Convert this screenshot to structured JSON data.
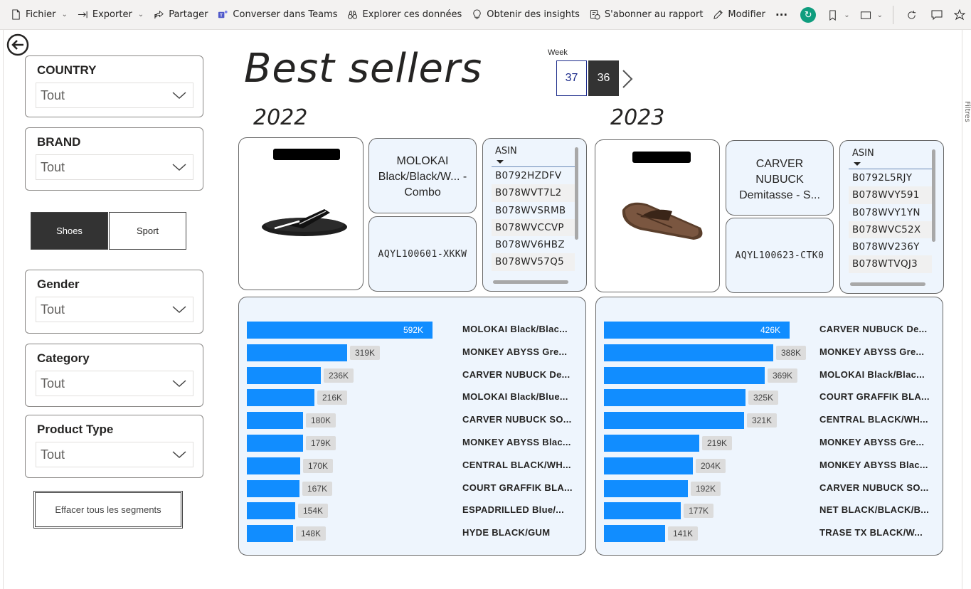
{
  "toolbar": {
    "items": [
      {
        "label": "Fichier",
        "icon": "file-icon",
        "chevron": true
      },
      {
        "label": "Exporter",
        "icon": "export-arrow-icon",
        "chevron": true
      },
      {
        "label": "Partager",
        "icon": "share-icon",
        "chevron": false
      },
      {
        "label": "Converser dans Teams",
        "icon": "teams-icon",
        "chevron": false
      },
      {
        "label": "Explorer ces données",
        "icon": "binoculars-icon",
        "chevron": false
      },
      {
        "label": "Obtenir des insights",
        "icon": "lightbulb-icon",
        "chevron": false
      },
      {
        "label": "S'abonner au rapport",
        "icon": "subscribe-icon",
        "chevron": false
      },
      {
        "label": "Modifier",
        "icon": "pencil-icon",
        "chevron": false
      }
    ],
    "more": "···"
  },
  "filters_pane_label": "Filtres",
  "slicers": {
    "country": {
      "title": "COUNTRY",
      "value": "Tout"
    },
    "brand": {
      "title": "BRAND",
      "value": "Tout"
    },
    "gender": {
      "title": "Gender",
      "value": "Tout"
    },
    "category": {
      "title": "Category",
      "value": "Tout"
    },
    "product_type": {
      "title": "Product Type",
      "value": "Tout"
    }
  },
  "segments": {
    "shoes": "Shoes",
    "sport": "Sport",
    "clear_all": "Effacer tous les segments"
  },
  "page_title": "Best sellers",
  "week": {
    "label": "Week",
    "options": [
      "37",
      "36"
    ],
    "selected": "36"
  },
  "years": {
    "y2022": {
      "label": "2022",
      "product_name": "MOLOKAI Black/Black/W... - Combo",
      "product_code": "AQYL100601-XKKW",
      "asin_header": "ASIN",
      "asins": [
        "B0792HZDFV",
        "B078WVT7L2",
        "B078WVSRMB",
        "B078WVCCVP",
        "B078WV6HBZ",
        "B078WV57Q5"
      ]
    },
    "y2023": {
      "label": "2023",
      "product_name": "CARVER NUBUCK Demitasse - S...",
      "product_code": "AQYL100623-CTK0",
      "asin_header": "ASIN",
      "asins": [
        "B0792L5RJY",
        "B078WVY591",
        "B078WVY1YN",
        "B078WVC52X",
        "B078WV236Y",
        "B078WTVQJ3"
      ]
    }
  },
  "colors": {
    "bar": "#118dff",
    "panel": "#eef5fd",
    "active_button": "#333333"
  },
  "chart_data": [
    {
      "type": "bar",
      "orientation": "horizontal",
      "title": "2022",
      "categories": [
        "MOLOKAI Black/Blac...",
        "MONKEY ABYSS Gre...",
        "CARVER NUBUCK De...",
        "MOLOKAI Black/Blue...",
        "CARVER NUBUCK SO...",
        "MONKEY ABYSS Blac...",
        "CENTRAL BLACK/WH...",
        "COURT GRAFFIK BLA...",
        "ESPADRILLED Blue/...",
        "HYDE BLACK/GUM"
      ],
      "values": [
        592,
        319,
        236,
        216,
        180,
        179,
        170,
        167,
        154,
        148
      ],
      "value_labels": [
        "592K",
        "319K",
        "236K",
        "216K",
        "180K",
        "179K",
        "170K",
        "167K",
        "154K",
        "148K"
      ],
      "max": 592
    },
    {
      "type": "bar",
      "orientation": "horizontal",
      "title": "2023",
      "categories": [
        "CARVER NUBUCK De...",
        "MONKEY ABYSS Gre...",
        "MOLOKAI Black/Blac...",
        "COURT GRAFFIK BLA...",
        "CENTRAL BLACK/WH...",
        "MONKEY ABYSS Gre...",
        "MONKEY ABYSS Blac...",
        "CARVER NUBUCK SO...",
        "NET BLACK/BLACK/B...",
        "TRASE TX BLACK/W..."
      ],
      "values": [
        426,
        388,
        369,
        325,
        321,
        219,
        204,
        192,
        177,
        141
      ],
      "value_labels": [
        "426K",
        "388K",
        "369K",
        "325K",
        "321K",
        "219K",
        "204K",
        "192K",
        "177K",
        "141K"
      ],
      "max": 426
    }
  ]
}
